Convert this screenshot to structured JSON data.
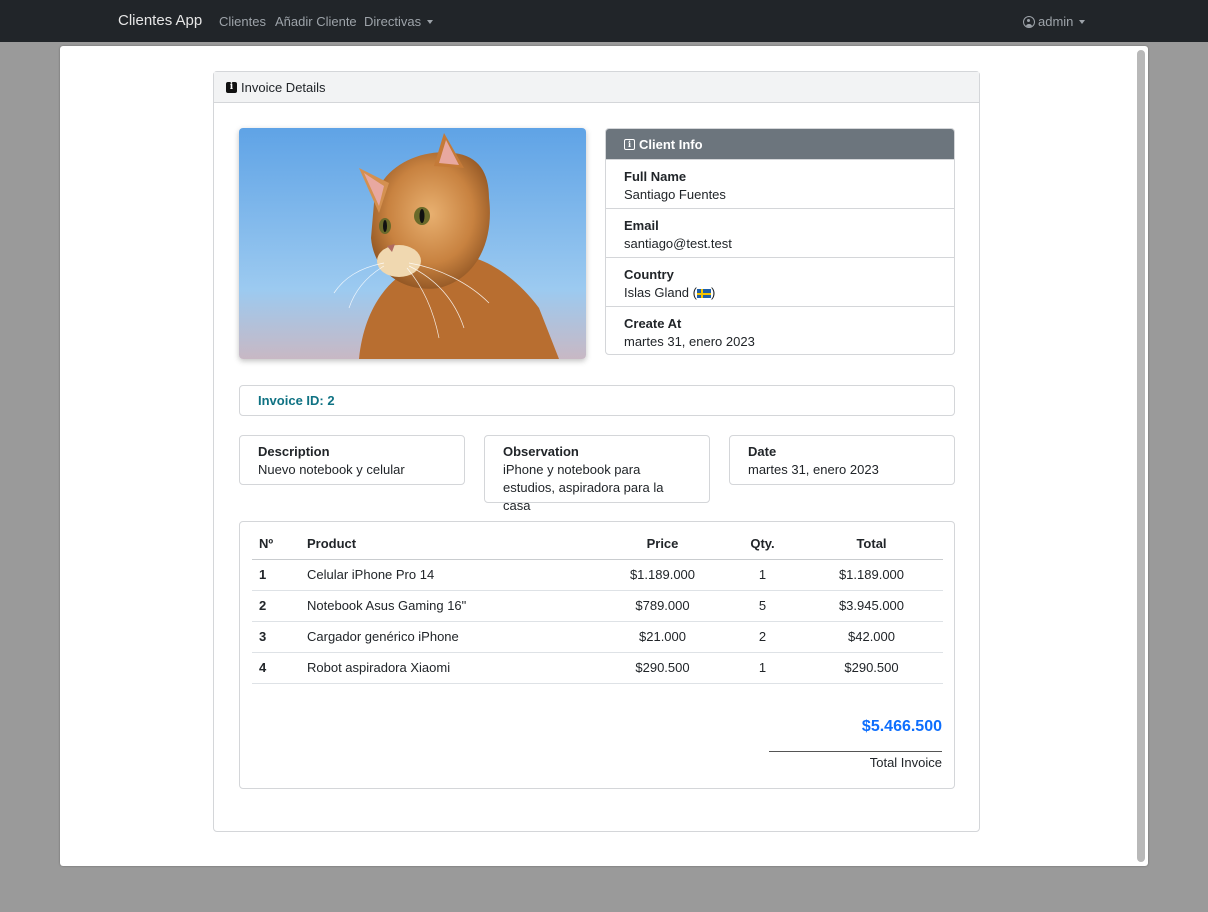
{
  "navbar": {
    "brand": "Clientes App",
    "links": [
      "Clientes",
      "Añadir Cliente",
      "Directivas"
    ],
    "user": "admin"
  },
  "card": {
    "title": "Invoice Details"
  },
  "client_info": {
    "title": "Client Info",
    "full_name_label": "Full Name",
    "full_name": "Santiago Fuentes",
    "email_label": "Email",
    "email": "santiago@test.test",
    "country_label": "Country",
    "country": "Islas Gland (",
    "country_close": ")",
    "created_label": "Create At",
    "created": "martes 31, enero 2023"
  },
  "invoice": {
    "id_text": "Invoice ID: 2",
    "description_label": "Description",
    "description": "Nuevo notebook y celular",
    "observation_label": "Observation",
    "observation": "iPhone y notebook para estudios, aspiradora para la casa",
    "date_label": "Date",
    "date": "martes 31, enero 2023"
  },
  "table": {
    "headers": [
      "Nº",
      "Product",
      "Price",
      "Qty.",
      "Total"
    ],
    "rows": [
      {
        "n": "1",
        "product": "Celular iPhone Pro 14",
        "price": "$1.189.000",
        "qty": "1",
        "total": "$1.189.000"
      },
      {
        "n": "2",
        "product": "Notebook Asus Gaming 16\"",
        "price": "$789.000",
        "qty": "5",
        "total": "$3.945.000"
      },
      {
        "n": "3",
        "product": "Cargador genérico iPhone",
        "price": "$21.000",
        "qty": "2",
        "total": "$42.000"
      },
      {
        "n": "4",
        "product": "Robot aspiradora Xiaomi",
        "price": "$290.500",
        "qty": "1",
        "total": "$290.500"
      }
    ],
    "total_amount": "$5.466.500",
    "total_label": "Total Invoice"
  },
  "colors": {
    "navbar": "#212529",
    "accent": "#0d6efd",
    "invoice_id": "#0f7283",
    "client_header": "#6c757d"
  }
}
